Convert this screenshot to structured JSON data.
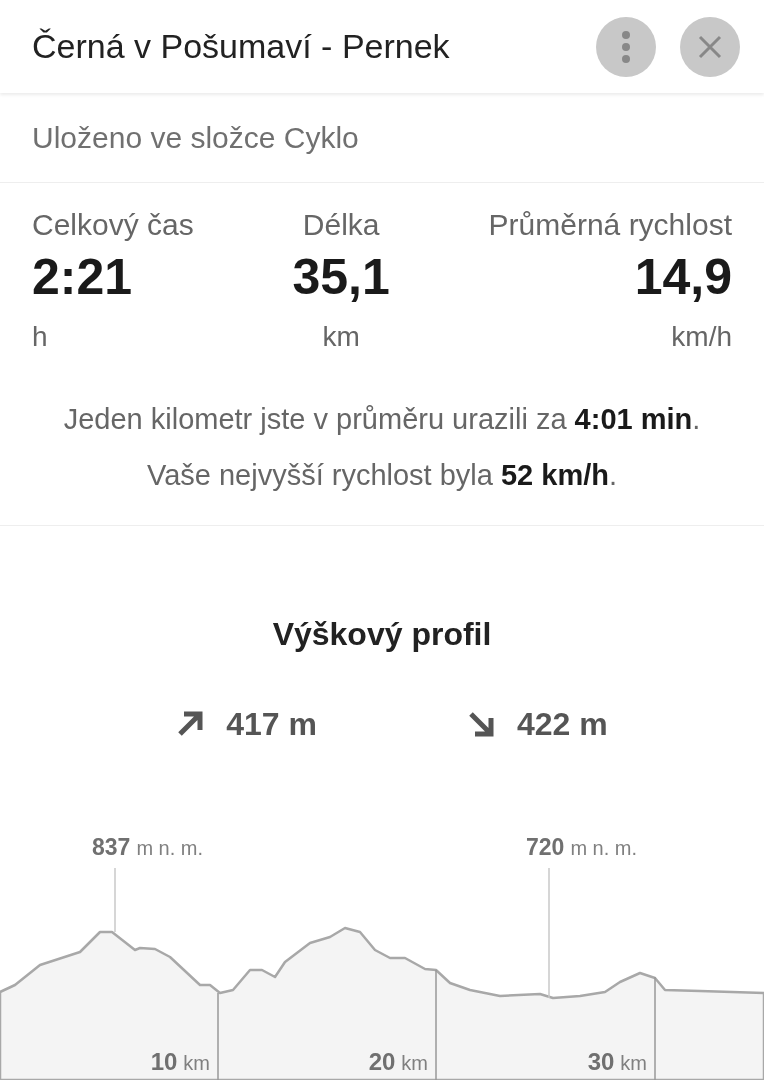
{
  "header": {
    "title": "Černá v Pošumaví - Pernek",
    "buttons": [
      {
        "kind": "more"
      },
      {
        "kind": "close"
      }
    ]
  },
  "folder_note": "Uloženo ve složce Cyklo",
  "stats": [
    {
      "label": "Celkový čas",
      "value": "2:21",
      "unit": "h"
    },
    {
      "label": "Délka",
      "value": "35,1",
      "unit": "km"
    },
    {
      "label": "Průměrná rychlost",
      "value": "14,9",
      "unit": "km/h"
    }
  ],
  "summary": [
    "Jeden kilometr jste v průměru urazili za **4:01 min**.",
    "Vaše nejvyšší rychlost byla **52 km/h**."
  ],
  "elevation_profile": {
    "title": "Výškový profil",
    "totals": [
      {
        "kind": "ascent",
        "value": "417 m"
      },
      {
        "kind": "descent",
        "value": "422 m"
      }
    ],
    "peaks": [
      {
        "value": "837",
        "unit": "m n. m."
      },
      {
        "value": "720",
        "unit": "m n. m."
      }
    ],
    "distance_marks": [
      {
        "value": "10",
        "unit": "km"
      },
      {
        "value": "20",
        "unit": "km"
      },
      {
        "value": "30",
        "unit": "km"
      }
    ]
  }
}
